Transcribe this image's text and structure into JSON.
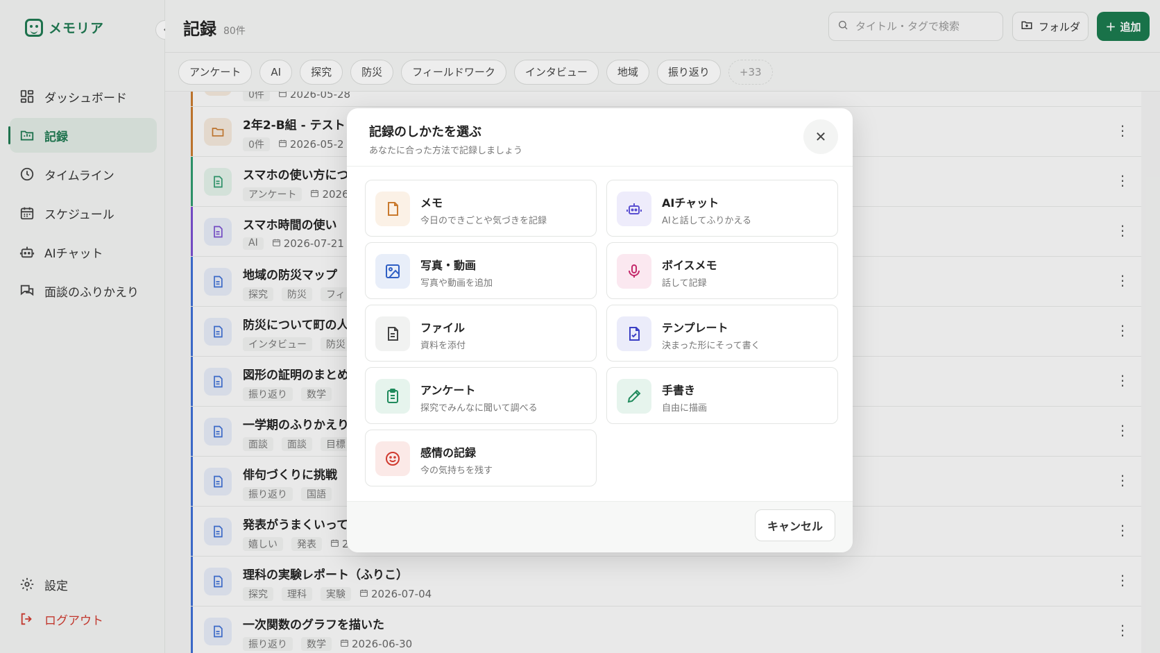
{
  "app": {
    "name": "メモリア"
  },
  "sidebar": {
    "items": [
      {
        "label": "ダッシュボード",
        "icon": "dashboard-icon"
      },
      {
        "label": "記録",
        "icon": "folder-icon",
        "active": true
      },
      {
        "label": "タイムライン",
        "icon": "clock-icon"
      },
      {
        "label": "スケジュール",
        "icon": "calendar-icon"
      },
      {
        "label": "AIチャット",
        "icon": "robot-icon"
      },
      {
        "label": "面談のふりかえり",
        "icon": "chat-icon"
      }
    ],
    "bottom": [
      {
        "label": "設定",
        "icon": "gear-icon"
      },
      {
        "label": "ログアウト",
        "icon": "logout-icon"
      }
    ]
  },
  "header": {
    "title": "記録",
    "count": "80件",
    "search_placeholder": "タイトル・タグで検索",
    "folder_label": "フォルダ",
    "add_label": "追加"
  },
  "tags": [
    "アンケート",
    "AI",
    "探究",
    "防災",
    "フィールドワーク",
    "インタビュー",
    "地域",
    "振り返り",
    "+33"
  ],
  "records": [
    {
      "title": "",
      "meta": [
        "0件"
      ],
      "date": "2026-05-28",
      "kind": "folder",
      "color": "#c97a2e"
    },
    {
      "title": "2年2-B組 - テスト",
      "meta": [
        "0件"
      ],
      "date": "2026-05-2",
      "kind": "folder",
      "color": "#c97a2e"
    },
    {
      "title": "スマホの使い方につ",
      "meta": [
        "アンケート"
      ],
      "date": "2026",
      "kind": "survey",
      "color": "#2e9b6e"
    },
    {
      "title": "スマホ時間の使い",
      "meta": [
        "AI"
      ],
      "date": "2026-07-21",
      "kind": "doc",
      "color": "#7a4fd1"
    },
    {
      "title": "地域の防災マップ",
      "meta": [
        "探究",
        "防災",
        "フィ"
      ],
      "date": "",
      "kind": "doc",
      "color": "#3d6fd6"
    },
    {
      "title": "防災について町の人",
      "meta": [
        "インタビュー",
        "防災"
      ],
      "date": "",
      "kind": "doc",
      "color": "#3d6fd6"
    },
    {
      "title": "図形の証明のまとめ",
      "meta": [
        "振り返り",
        "数学"
      ],
      "date": "",
      "kind": "doc",
      "color": "#3d6fd6"
    },
    {
      "title": "一学期のふりかえり",
      "meta": [
        "面談",
        "面談",
        "目標"
      ],
      "date": "",
      "kind": "doc",
      "color": "#3d6fd6"
    },
    {
      "title": "俳句づくりに挑戦",
      "meta": [
        "振り返り",
        "国語"
      ],
      "date": "",
      "kind": "doc",
      "color": "#3d6fd6"
    },
    {
      "title": "発表がうまくいって",
      "meta": [
        "嬉しい",
        "発表"
      ],
      "date": "2",
      "kind": "doc",
      "color": "#3d6fd6"
    },
    {
      "title": "理科の実験レポート（ふりこ）",
      "meta": [
        "探究",
        "理科",
        "実験"
      ],
      "date": "2026-07-04",
      "kind": "doc",
      "color": "#3d6fd6"
    },
    {
      "title": "一次関数のグラフを描いた",
      "meta": [
        "振り返り",
        "数学"
      ],
      "date": "2026-06-30",
      "kind": "doc",
      "color": "#3d6fd6"
    }
  ],
  "modal": {
    "title": "記録のしかたを選ぶ",
    "subtitle": "あなたに合った方法で記録しましょう",
    "cancel_label": "キャンセル",
    "options": [
      {
        "label": "メモ",
        "desc": "今日のできごとや気づきを記録",
        "icon": "memo-icon",
        "color": "#c97a2e",
        "bg": "#fbf1e6"
      },
      {
        "label": "AIチャット",
        "desc": "AIと話してふりかえる",
        "icon": "robot-icon",
        "color": "#5a4fd1",
        "bg": "#eeecfb"
      },
      {
        "label": "写真・動画",
        "desc": "写真や動画を追加",
        "icon": "image-icon",
        "color": "#2f5fc4",
        "bg": "#e8eef9"
      },
      {
        "label": "ボイスメモ",
        "desc": "話して記録",
        "icon": "microphone-icon",
        "color": "#c4286a",
        "bg": "#fbe8f0"
      },
      {
        "label": "ファイル",
        "desc": "資料を添付",
        "icon": "file-icon",
        "color": "#444444",
        "bg": "#f1f2f1"
      },
      {
        "label": "テンプレート",
        "desc": "決まった形にそって書く",
        "icon": "template-icon",
        "color": "#3b3fc4",
        "bg": "#ebecfa"
      },
      {
        "label": "アンケート",
        "desc": "探究でみんなに聞いて調べる",
        "icon": "clipboard-icon",
        "color": "#1f8a5c",
        "bg": "#e6f4ed"
      },
      {
        "label": "手書き",
        "desc": "自由に描画",
        "icon": "pencil-icon",
        "color": "#1f8a5c",
        "bg": "#e6f4ed"
      },
      {
        "label": "感情の記録",
        "desc": "今の気持ちを残す",
        "icon": "smile-icon",
        "color": "#d03a2f",
        "bg": "#fbe9e7"
      }
    ]
  }
}
